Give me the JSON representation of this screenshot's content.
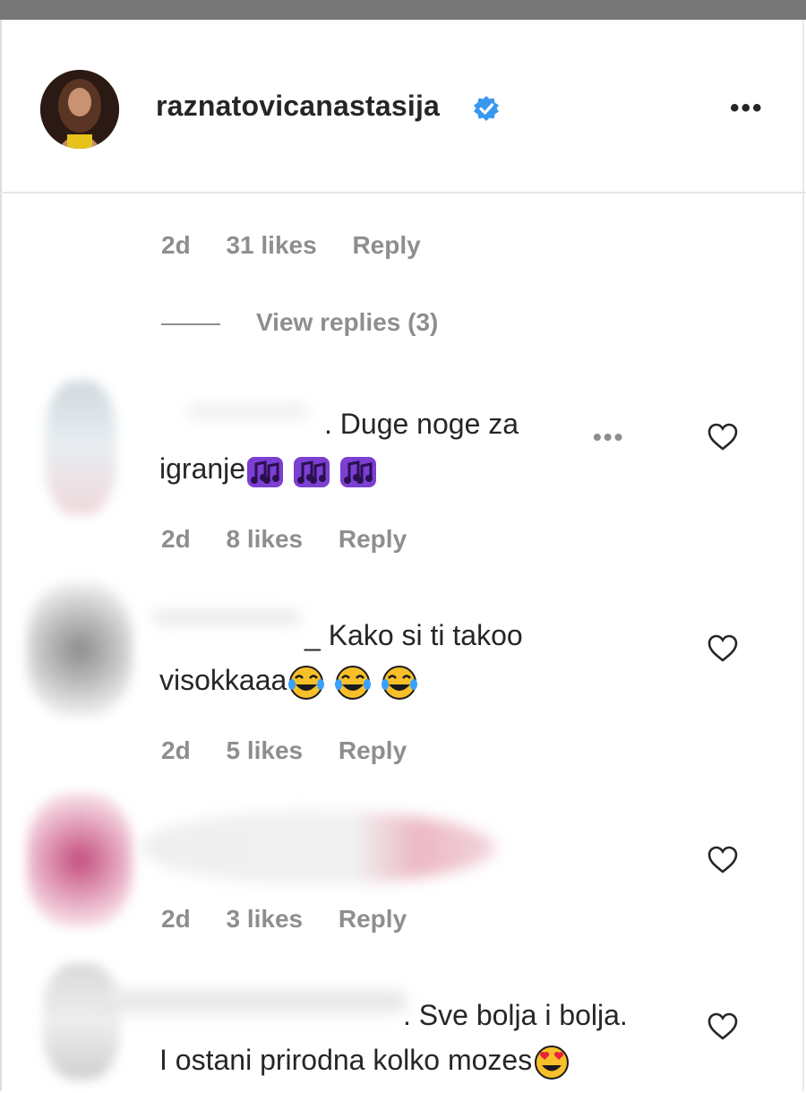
{
  "post": {
    "username": "raznatovicanastasija",
    "verified": true,
    "more_label": "•••"
  },
  "top_comment": {
    "age": "2d",
    "likes": "31 likes",
    "reply": "Reply",
    "view_replies": "View replies (3)"
  },
  "comments": [
    {
      "text_line1": ". Duge noge za",
      "text_line2": "igranje",
      "emojis": [
        "music-note-emoji",
        "music-note-emoji",
        "music-note-emoji"
      ],
      "age": "2d",
      "likes": "8 likes",
      "reply": "Reply",
      "more_label": "•••"
    },
    {
      "text_line1": "_ Kako si ti takoo",
      "text_line2": "visokkaaa",
      "emojis": [
        "tears-of-joy-emoji",
        "tears-of-joy-emoji",
        "tears-of-joy-emoji"
      ],
      "age": "2d",
      "likes": "5 likes",
      "reply": "Reply"
    },
    {
      "text_line1": "",
      "age": "2d",
      "likes": "3 likes",
      "reply": "Reply"
    },
    {
      "text_line1": ". Sve bolja i bolja.",
      "text_line2": "I ostani prirodna kolko mozes",
      "emojis": [
        "heart-eyes-emoji"
      ]
    }
  ],
  "colors": {
    "verified_blue": "#3897f0",
    "meta_gray": "#8e8e8e",
    "text": "#262626",
    "emoji_purple": "#7b3fd1",
    "emoji_yellow": "#f7c02a"
  }
}
